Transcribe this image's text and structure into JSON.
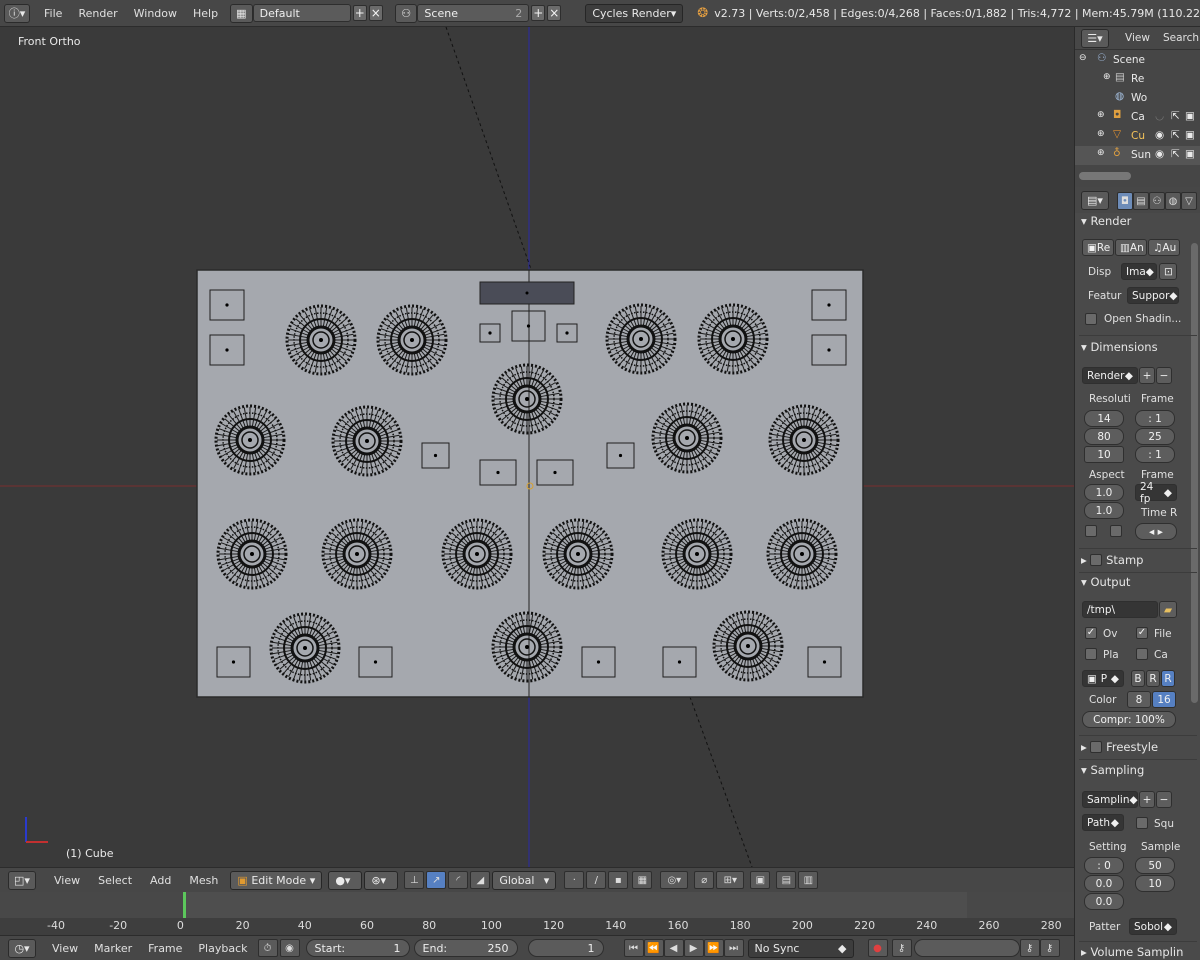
{
  "topbar": {
    "menus": [
      "File",
      "Render",
      "Window",
      "Help"
    ],
    "layout": "Default",
    "scene": "Scene",
    "scene_users": "2",
    "engine": "Cycles Render",
    "stats": "v2.73 | Verts:0/2,458 | Edges:0/4,268 | Faces:0/1,882 | Tris:4,772 | Mem:45.79M (110.22"
  },
  "viewport": {
    "view_name": "Front Ortho",
    "object_label": "(1) Cube"
  },
  "view3d_header": {
    "menus": [
      "View",
      "Select",
      "Add",
      "Mesh"
    ],
    "mode": "Edit Mode",
    "orientation": "Global"
  },
  "timeline": {
    "ticks": [
      "-40",
      "-20",
      "0",
      "20",
      "40",
      "60",
      "80",
      "100",
      "120",
      "140",
      "160",
      "180",
      "200",
      "220",
      "240",
      "260",
      "280"
    ],
    "menus": [
      "View",
      "Marker",
      "Frame",
      "Playback"
    ],
    "start_label": "Start:",
    "start_value": "1",
    "end_label": "End:",
    "end_value": "250",
    "current_frame": "1",
    "sync": "No Sync"
  },
  "outliner": {
    "view_menu": "View",
    "search_menu": "Search",
    "items": [
      "Scene",
      "Re",
      "Wo",
      "Ca",
      "Cu",
      "Sun"
    ]
  },
  "properties": {
    "render": {
      "header": "Render",
      "buttons": [
        "Re",
        "An",
        "Au"
      ],
      "display_label": "Disp",
      "display_value": "Ima",
      "feature_label": "Featur",
      "feature_value": "Suppor",
      "osl_label": "Open Shadin..."
    },
    "dimensions": {
      "header": "Dimensions",
      "preset": "Render",
      "resolution_label": "Resoluti",
      "res_x": "14",
      "res_y": "80",
      "res_pct": "10",
      "frame_label": "Frame",
      "frame_start": ": 1",
      "frame_end": "25",
      "frame_step": ": 1",
      "aspect_label": "Aspect",
      "aspect_x": "1.0",
      "aspect_y": "1.0",
      "fps_label": "Frame",
      "fps_value": "24 fp",
      "time_label": "Time R"
    },
    "stamp": {
      "header": "Stamp"
    },
    "output": {
      "header": "Output",
      "path": "/tmp\\",
      "overwrite": "Ov",
      "file_ext": "File",
      "placeholders": "Pla",
      "cache": "Ca",
      "format": "P",
      "bw": "B",
      "rgb": "R",
      "rgba": "R",
      "color_label": "Color",
      "depth_8": "8",
      "depth_16": "16",
      "compression": "Compr: 100%"
    },
    "freestyle": {
      "header": "Freestyle"
    },
    "sampling": {
      "header": "Sampling",
      "preset": "Samplin",
      "integrator": "Path",
      "square": "Squ",
      "settings_label": "Setting",
      "samples_label": "Sample",
      "seed": ": 0",
      "clamp_direct": "0.0",
      "clamp_indirect": "0.0",
      "render_samples": "50",
      "preview_samples": "10",
      "pattern_label": "Patter",
      "pattern_value": "Sobol"
    },
    "volume_sampling": {
      "header": "Volume Samplin"
    }
  },
  "colors": {
    "mesh_face": "#a5a8ae",
    "background": "#393939",
    "axis_x": "#8b2b2b",
    "axis_z": "#2b2bb0"
  }
}
